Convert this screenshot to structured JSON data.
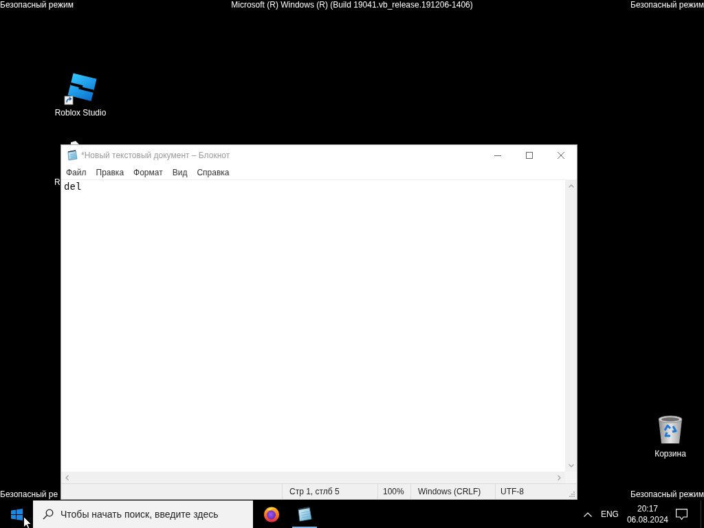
{
  "top_bar": {
    "left": "Безопасный режим",
    "center": "Microsoft (R) Windows (R) (Build 19041.vb_release.191206-1406)",
    "right": "Безопасный режим"
  },
  "desktop_icons": [
    {
      "kind": "studio",
      "label": "Roblox Studio"
    },
    {
      "kind": "hidden",
      "label": "R"
    },
    {
      "kind": "recycle_bin",
      "label": "Корзина"
    }
  ],
  "notepad": {
    "title": "*Новый текстовый документ – Блокнот",
    "menu": [
      "Файл",
      "Правка",
      "Формат",
      "Вид",
      "Справка"
    ],
    "text": "del",
    "status_bar": [
      "Стр 1, стлб 5",
      "100%",
      "Windows (CRLF)",
      "UTF-8"
    ]
  },
  "bottom_bar": {
    "left": "Безопасный ре",
    "right": "Безопасный режим"
  },
  "taskbar": {
    "search": {
      "placeholder": "Чтобы начать поиск, введите здесь"
    },
    "apps": [
      {
        "kind": "browser",
        "open": false
      },
      {
        "kind": "notepad",
        "open": true
      }
    ],
    "tray": {
      "language": "ENG",
      "time": "20:17",
      "date": "06.08.2024"
    }
  }
}
